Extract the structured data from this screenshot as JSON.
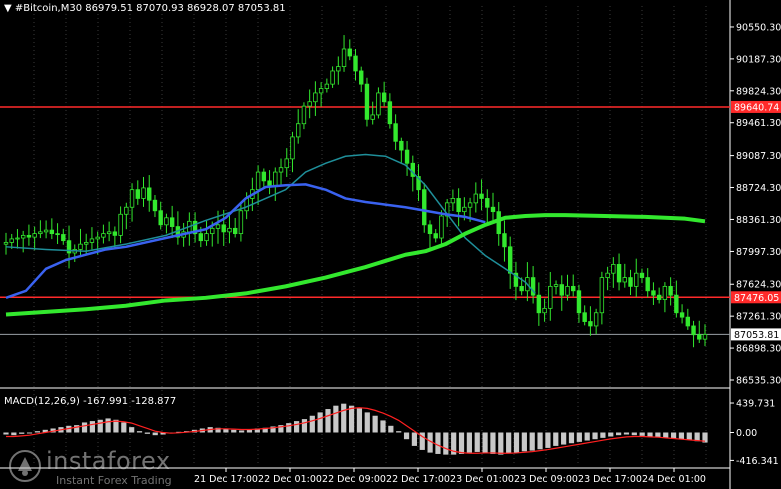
{
  "header": {
    "symbol_line": "▼ #Bitcoin,M30  86979.51 87070.93 86928.07 87053.81"
  },
  "macd_header": "MACD(12,26,9)  -167.991  -128.877",
  "watermark": {
    "brand": "instaforex",
    "tagline": "Instant Forex Trading"
  },
  "chart_data": {
    "type": "candlestick",
    "symbol": "#Bitcoin",
    "timeframe": "M30",
    "ohlc_last": {
      "open": 86979.51,
      "high": 87070.93,
      "low": 86928.07,
      "close": 87053.81
    },
    "price_axis": {
      "min": 86535.3,
      "max": 90675.0,
      "ticks": [
        "90550.30",
        "90187.30",
        "89824.30",
        "89461.30",
        "89087.30",
        "88724.30",
        "88361.30",
        "87997.30",
        "87624.30",
        "87261.30",
        "86898.30",
        "86535.30"
      ]
    },
    "time_axis_ticks": [
      "21 Dec 17:00",
      "22 Dec 01:00",
      "22 Dec 09:00",
      "22 Dec 17:00",
      "23 Dec 01:00",
      "23 Dec 09:00",
      "23 Dec 17:00",
      "24 Dec 01:00"
    ],
    "levels": [
      {
        "label": "89640.74",
        "value": 89640.74,
        "color": "#ff2a2a"
      },
      {
        "label": "87476.05",
        "value": 87476.05,
        "color": "#ff2a2a"
      },
      {
        "label": "87053.81",
        "value": 87053.81,
        "color": "#9aa0a6",
        "current": true
      }
    ],
    "ma_lines": [
      {
        "name": "MA fast",
        "color": "#1f8f9a",
        "values": [
          [
            0,
            88050
          ],
          [
            40,
            88020
          ],
          [
            80,
            88000
          ],
          [
            120,
            88080
          ],
          [
            160,
            88180
          ],
          [
            200,
            88350
          ],
          [
            240,
            88500
          ],
          [
            280,
            88700
          ],
          [
            300,
            88900
          ],
          [
            320,
            89000
          ],
          [
            340,
            89080
          ],
          [
            360,
            89100
          ],
          [
            380,
            89080
          ],
          [
            400,
            88980
          ],
          [
            420,
            88750
          ],
          [
            440,
            88450
          ],
          [
            460,
            88150
          ],
          [
            480,
            87950
          ],
          [
            500,
            87800
          ],
          [
            520,
            87650
          ],
          [
            530,
            87520
          ]
        ]
      },
      {
        "name": "MA mid",
        "color": "#3a62f0",
        "values": [
          [
            0,
            87470
          ],
          [
            20,
            87550
          ],
          [
            40,
            87800
          ],
          [
            60,
            87900
          ],
          [
            80,
            87960
          ],
          [
            100,
            88020
          ],
          [
            120,
            88050
          ],
          [
            140,
            88100
          ],
          [
            160,
            88150
          ],
          [
            180,
            88200
          ],
          [
            200,
            88250
          ],
          [
            220,
            88380
          ],
          [
            240,
            88600
          ],
          [
            260,
            88730
          ],
          [
            280,
            88750
          ],
          [
            300,
            88760
          ],
          [
            320,
            88700
          ],
          [
            340,
            88600
          ],
          [
            360,
            88560
          ],
          [
            380,
            88530
          ],
          [
            400,
            88500
          ],
          [
            420,
            88460
          ],
          [
            440,
            88420
          ],
          [
            460,
            88390
          ],
          [
            480,
            88330
          ]
        ]
      },
      {
        "name": "MA slow",
        "color": "#33e82e",
        "values": [
          [
            0,
            87280
          ],
          [
            40,
            87310
          ],
          [
            80,
            87340
          ],
          [
            120,
            87380
          ],
          [
            160,
            87440
          ],
          [
            200,
            87470
          ],
          [
            240,
            87520
          ],
          [
            280,
            87600
          ],
          [
            320,
            87700
          ],
          [
            360,
            87820
          ],
          [
            400,
            87960
          ],
          [
            420,
            88000
          ],
          [
            440,
            88080
          ],
          [
            460,
            88200
          ],
          [
            480,
            88300
          ],
          [
            500,
            88380
          ],
          [
            520,
            88400
          ],
          [
            540,
            88410
          ],
          [
            560,
            88410
          ],
          [
            600,
            88400
          ],
          [
            640,
            88390
          ],
          [
            680,
            88370
          ],
          [
            700,
            88340
          ]
        ]
      }
    ],
    "candles_close": [
      88100,
      88140,
      88150,
      88180,
      88160,
      88200,
      88220,
      88240,
      88200,
      88190,
      88120,
      87980,
      88020,
      88080,
      88100,
      88140,
      88160,
      88200,
      88220,
      88180,
      88420,
      88500,
      88700,
      88600,
      88720,
      88580,
      88460,
      88300,
      88380,
      88280,
      88160,
      88220,
      88340,
      88200,
      88120,
      88200,
      88260,
      88300,
      88220,
      88260,
      88200,
      88460,
      88600,
      88700,
      88900,
      88800,
      88750,
      88900,
      88950,
      89050,
      89300,
      89450,
      89650,
      89700,
      89800,
      89850,
      89900,
      90050,
      90100,
      90300,
      90220,
      90050,
      89900,
      89500,
      89550,
      89800,
      89700,
      89450,
      89250,
      89150,
      89000,
      88850,
      88700,
      88300,
      88200,
      88150,
      88400,
      88550,
      88600,
      88450,
      88500,
      88550,
      88650,
      88600,
      88500,
      88450,
      88200,
      88050,
      87750,
      87600,
      87550,
      87700,
      87500,
      87300,
      87350,
      87600,
      87620,
      87500,
      87600,
      87550,
      87300,
      87200,
      87150,
      87300,
      87700,
      87750,
      87850,
      87650,
      87700,
      87600,
      87750,
      87700,
      87550,
      87500,
      87450,
      87600,
      87500,
      87300,
      87250,
      87150,
      87050,
      87000,
      87053.81
    ],
    "macd": {
      "axis_ticks": [
        "439.731",
        "0.00",
        "-416.341"
      ],
      "axis_min": -470,
      "axis_max": 470,
      "histogram": [
        -30,
        -40,
        -20,
        -10,
        20,
        40,
        60,
        80,
        100,
        110,
        150,
        170,
        190,
        210,
        190,
        150,
        80,
        20,
        -20,
        -40,
        -30,
        -10,
        10,
        20,
        40,
        60,
        80,
        70,
        60,
        40,
        30,
        40,
        60,
        70,
        90,
        110,
        140,
        170,
        200,
        250,
        300,
        350,
        400,
        430,
        400,
        360,
        300,
        250,
        180,
        100,
        20,
        -100,
        -200,
        -260,
        -300,
        -320,
        -330,
        -330,
        -320,
        -300,
        -290,
        -300,
        -320,
        -330,
        -310,
        -300,
        -280,
        -270,
        -250,
        -230,
        -200,
        -180,
        -160,
        -140,
        -120,
        -100,
        -80,
        -60,
        -40,
        -30,
        -40,
        -50,
        -60,
        -70,
        -80,
        -90,
        -100,
        -110,
        -130,
        -150
      ],
      "signal": [
        -60,
        -60,
        -50,
        -40,
        -20,
        0,
        20,
        40,
        60,
        80,
        100,
        120,
        140,
        160,
        170,
        160,
        140,
        100,
        60,
        20,
        0,
        -10,
        -5,
        5,
        15,
        30,
        45,
        55,
        55,
        50,
        45,
        45,
        50,
        60,
        70,
        85,
        100,
        120,
        145,
        175,
        210,
        250,
        290,
        330,
        360,
        370,
        360,
        330,
        290,
        240,
        180,
        100,
        20,
        -60,
        -130,
        -190,
        -240,
        -280,
        -300,
        -310,
        -310,
        -305,
        -305,
        -310,
        -310,
        -305,
        -295,
        -285,
        -270,
        -255,
        -235,
        -215,
        -195,
        -175,
        -155,
        -135,
        -115,
        -95,
        -80,
        -65,
        -60,
        -60,
        -65,
        -70,
        -80,
        -90,
        -100,
        -110,
        -120,
        -130
      ]
    }
  }
}
